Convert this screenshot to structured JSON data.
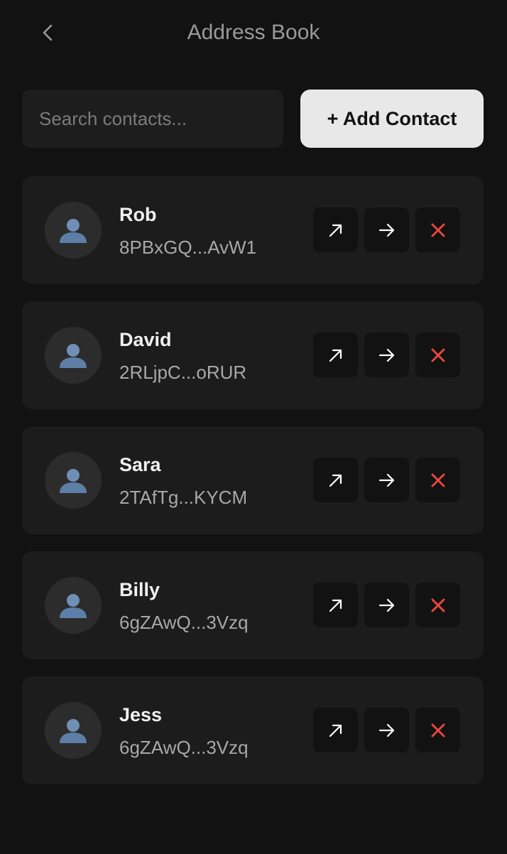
{
  "header": {
    "title": "Address Book",
    "back_icon": "chevron-left-icon"
  },
  "search": {
    "placeholder": "Search contacts...",
    "value": ""
  },
  "toolbar": {
    "add_label": "+ Add Contact"
  },
  "colors": {
    "background": "#121212",
    "card": "#1c1c1c",
    "button_light": "#e8e8e8",
    "delete_red": "#e5483b",
    "avatar_blue": "#6f8fb5"
  },
  "contacts": [
    {
      "name": "Rob",
      "address": "8PBxGQ...AvW1"
    },
    {
      "name": "David",
      "address": "2RLjpC...oRUR"
    },
    {
      "name": "Sara",
      "address": "2TAfTg...KYCM"
    },
    {
      "name": "Billy",
      "address": "6gZAwQ...3Vzq"
    },
    {
      "name": "Jess",
      "address": "6gZAwQ...3Vzq"
    }
  ],
  "action_icons": [
    "arrow-up-right-icon",
    "arrow-right-icon",
    "close-icon"
  ]
}
